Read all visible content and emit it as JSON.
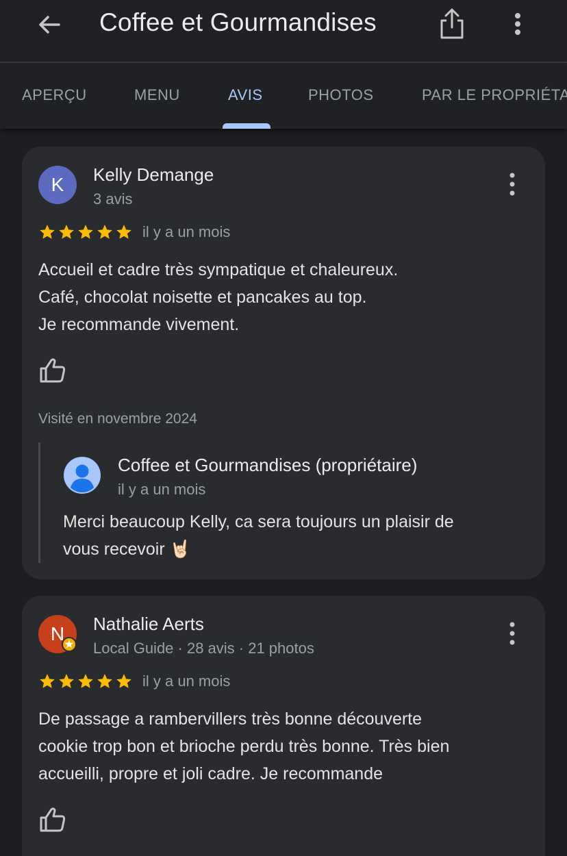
{
  "appbar": {
    "title": "Coffee et Gourmandises"
  },
  "tabs": [
    {
      "label": "APERÇU",
      "active": false
    },
    {
      "label": "MENU",
      "active": false
    },
    {
      "label": "AVIS",
      "active": true
    },
    {
      "label": "PHOTOS",
      "active": false
    },
    {
      "label": "PAR LE PROPRIÉTA",
      "active": false
    }
  ],
  "colors": {
    "background": "#1c1d20",
    "card": "#2a2b2e",
    "accent": "#a8c7fa",
    "star": "#fbbc04",
    "avatar_k": "#5c6bc0",
    "avatar_n": "#c5401b"
  },
  "reviews": [
    {
      "avatar_letter": "K",
      "name": "Kelly Demange",
      "meta": "3 avis",
      "rating": 5,
      "when": "il y a un mois",
      "lines": [
        "Accueil et cadre très sympatique et chaleureux.",
        "Café, chocolat noisette et pancakes au top.",
        "Je recommande vivement."
      ],
      "visited": "Visité en novembre 2024",
      "reply": {
        "owner": "Coffee et Gourmandises (propriétaire)",
        "when": "il y a un mois",
        "lines": [
          "Merci beaucoup Kelly, ca sera toujours un plaisir de",
          "vous recevoir 🤘🏻"
        ]
      }
    },
    {
      "avatar_letter": "N",
      "name": "Nathalie Aerts",
      "meta": "Local Guide · 28 avis · 21 photos",
      "rating": 5,
      "when": "il y a un mois",
      "lines": [
        "De passage a rambervillers très bonne découverte",
        "cookie trop bon et brioche perdu très bonne. Très bien",
        "accueilli, propre et joli cadre. Je recommande"
      ]
    }
  ],
  "icons": [
    "back-arrow-icon",
    "share-icon",
    "more-vert-icon",
    "star-icon",
    "thumb-up-icon",
    "person-icon",
    "local-guide-badge-icon"
  ]
}
